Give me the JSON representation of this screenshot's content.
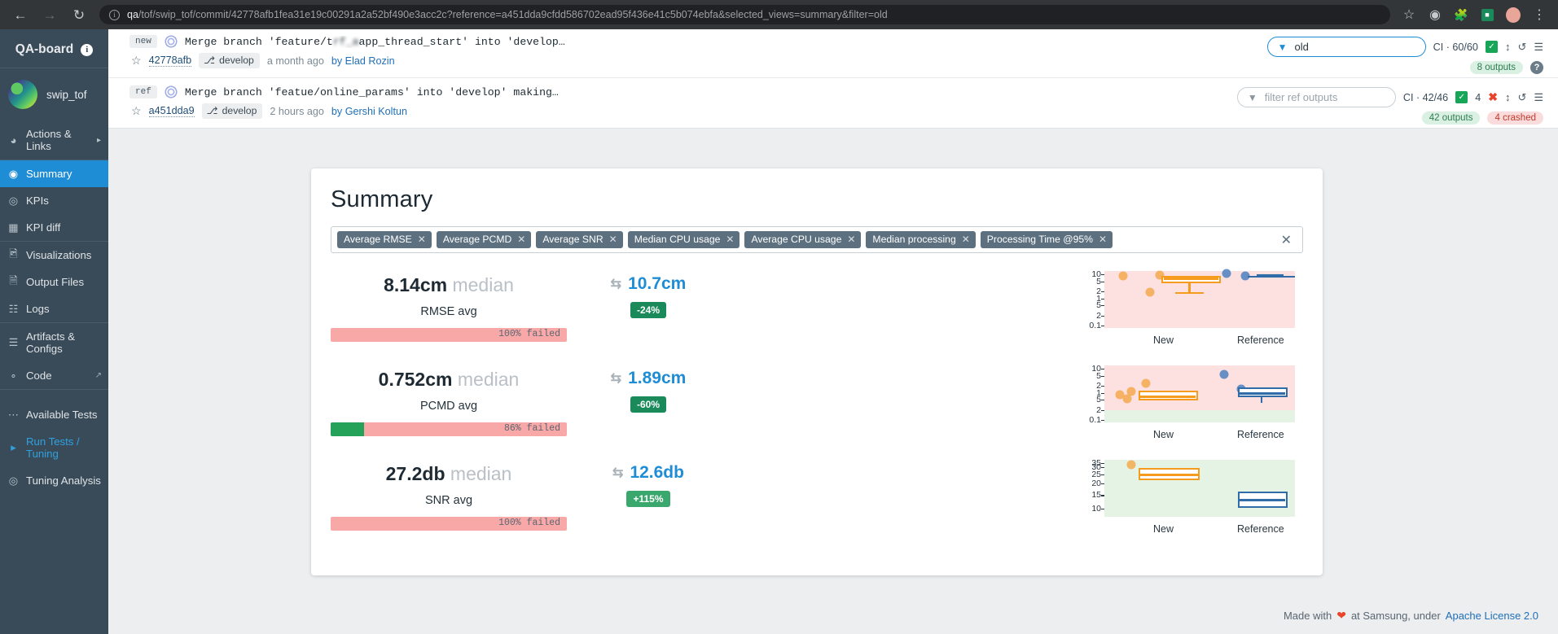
{
  "browser": {
    "back_icon": "arrow-left-icon",
    "forward_icon": "arrow-right-icon",
    "reload_icon": "reload-icon",
    "info_icon": "info-circle-icon",
    "url_host": "qa",
    "url_rest": "/tof/swip_tof/commit/42778afb1fea31e19c00291a2a52bf490e3acc2c?reference=a451dda9cfdd586702ead95f436e41c5b074ebfa&selected_views=summary&filter=old",
    "star_icon": "bookmark-star-icon",
    "extension_icon": "extension-icon",
    "puzzle_icon": "puzzle-icon",
    "green_icon": "green-badge-icon",
    "profile_icon": "profile-avatar-icon",
    "menu_icon": "chrome-menu-icon"
  },
  "sidebar": {
    "brand": "QA-board",
    "brand_info_icon": "info-icon",
    "project": "swip_tof",
    "project_thumb_icon": "project-thumbnail",
    "items": [
      {
        "label": "Actions & Links",
        "icon": "actions-links-icon",
        "active": false,
        "chevron": "▸"
      },
      {
        "label": "Summary",
        "icon": "summary-icon",
        "active": true
      },
      {
        "label": "KPIs",
        "icon": "kpis-icon",
        "active": false
      },
      {
        "label": "KPI diff",
        "icon": "kpi-diff-icon",
        "active": false
      },
      {
        "label": "Visualizations",
        "icon": "visualizations-icon",
        "active": false
      },
      {
        "label": "Output Files",
        "icon": "output-files-icon",
        "active": false
      },
      {
        "label": "Logs",
        "icon": "logs-icon",
        "active": false
      },
      {
        "label": "Artifacts & Configs",
        "icon": "artifacts-configs-icon",
        "active": false
      },
      {
        "label": "Code",
        "icon": "code-icon",
        "active": false,
        "external": "↗"
      },
      {
        "label": "Available Tests",
        "icon": "available-tests-icon",
        "active": false
      },
      {
        "label": "Run Tests / Tuning",
        "icon": "run-tests-icon",
        "active": false,
        "accent": true
      },
      {
        "label": "Tuning Analysis",
        "icon": "tuning-analysis-icon",
        "active": false
      }
    ]
  },
  "commits": {
    "new": {
      "tag": "new",
      "avatar_icon": "commit-identicon",
      "message_pre": "Merge branch 'feature/t",
      "message_blur": "rf_a",
      "message_post": "app_thread_start' into 'develop…",
      "star_icon": "star-icon",
      "hash": "42778afb",
      "branch_icon": "git-branch-icon",
      "branch": "develop",
      "when": "a month ago",
      "by": "by Elad Rozin",
      "filter_icon": "funnel-icon",
      "filter_value": "old",
      "ci_label": "CI · 60/60",
      "ci_check_icon": "check-icon",
      "sort_icon": "sort-icon",
      "refresh_icon": "refresh-icon",
      "menu_icon": "hamburger-menu-icon",
      "outputs_pill": "8 outputs",
      "help_icon": "question-mark-icon"
    },
    "ref": {
      "tag": "ref",
      "avatar_icon": "commit-identicon",
      "message": "Merge branch 'featue/online_params' into 'develop' making…",
      "star_icon": "star-icon",
      "hash": "a451dda9",
      "branch_icon": "git-branch-icon",
      "branch": "develop",
      "when": "2 hours ago",
      "by": "by Gershi Koltun",
      "filter_icon": "funnel-icon",
      "filter_placeholder": "filter ref outputs",
      "ci_label": "CI · 42/46",
      "ci_check_icon": "check-icon",
      "fail_count": "4",
      "fail_icon": "x-cross-icon",
      "sort_icon": "sort-icon",
      "refresh_icon": "refresh-icon",
      "menu_icon": "hamburger-menu-icon",
      "outputs_pill": "42 outputs",
      "crashed_pill": "4 crashed"
    }
  },
  "summary": {
    "title": "Summary",
    "tags": [
      "Average RMSE",
      "Average PCMD",
      "Average SNR",
      "Median CPU usage",
      "Average CPU usage",
      "Median processing",
      "Processing Time @95%"
    ],
    "tag_remove_icon": "x-icon",
    "clear_all_icon": "clear-all-x-icon",
    "metrics": [
      {
        "value": "8.14cm",
        "value_suffix": "median",
        "label": "RMSE avg",
        "bar_text": "100% failed",
        "bar_pass_pct": 0,
        "ref_value": "10.7cm",
        "compare_icon": "compare-arrows-icon",
        "delta": "-24%",
        "delta_kind": "neg"
      },
      {
        "value": "0.752cm",
        "value_suffix": "median",
        "label": "PCMD avg",
        "bar_text": "86% failed",
        "bar_pass_pct": 14,
        "ref_value": "1.89cm",
        "compare_icon": "compare-arrows-icon",
        "delta": "-60%",
        "delta_kind": "neg"
      },
      {
        "value": "27.2db",
        "value_suffix": "median",
        "label": "SNR avg",
        "bar_text": "100% failed",
        "bar_pass_pct": 0,
        "ref_value": "12.6db",
        "compare_icon": "compare-arrows-icon",
        "delta": "+115%",
        "delta_kind": "pos"
      }
    ]
  },
  "chart_data": [
    {
      "type": "box",
      "metric": "RMSE avg",
      "ylabel": "",
      "ytick_labels": [
        "10",
        "5",
        "2",
        "1",
        "5",
        "2",
        "0.1"
      ],
      "xtick_labels": [
        "New",
        "Reference"
      ],
      "background": "#fde0e0",
      "series": [
        {
          "name": "New",
          "color": "#f59c1f",
          "points": [
            9.0,
            9.5,
            2.0
          ],
          "box": {
            "q1": 5.2,
            "median": 7.0,
            "q3": 9.3,
            "low_whisker": 2.0
          }
        },
        {
          "name": "Reference",
          "color": "#2f6ca8",
          "points": [
            10.5,
            10.0
          ],
          "box": {
            "q1": 9.8,
            "median": 10.0,
            "q3": 10.3,
            "high_whisker": 10.5
          }
        }
      ]
    },
    {
      "type": "box",
      "metric": "PCMD avg",
      "ytick_labels": [
        "10",
        "5",
        "2",
        "1",
        "5",
        "2",
        "0.1"
      ],
      "xtick_labels": [
        "New",
        "Reference"
      ],
      "background": "#fde0e0",
      "band_bottom": "#e4f3e4",
      "series": [
        {
          "name": "New",
          "color": "#f59c1f",
          "points": [
            0.9,
            1.2,
            1.0,
            0.8
          ],
          "box": {
            "q1": 0.6,
            "median": 0.75,
            "q3": 1.1
          }
        },
        {
          "name": "Reference",
          "color": "#2f6ca8",
          "points": [
            5.0,
            2.2
          ],
          "box": {
            "q1": 1.5,
            "median": 1.9,
            "q3": 2.6
          }
        }
      ]
    },
    {
      "type": "box",
      "metric": "SNR avg",
      "ytick_labels": [
        "35",
        "30",
        "25",
        "20",
        "15",
        "10"
      ],
      "xtick_labels": [
        "New",
        "Reference"
      ],
      "background": "#e4f3e4",
      "series": [
        {
          "name": "New",
          "color": "#f59c1f",
          "points": [
            31.0
          ],
          "box": {
            "q1": 24.0,
            "median": 27.2,
            "q3": 30.0
          }
        },
        {
          "name": "Reference",
          "color": "#2f6ca8",
          "points": [],
          "box": {
            "q1": 10.5,
            "median": 12.6,
            "q3": 15.0
          }
        }
      ]
    }
  ],
  "footer": {
    "made_with": "Made with",
    "heart_icon": "heart-icon",
    "at": "at Samsung, under",
    "license": "Apache License 2.0"
  }
}
